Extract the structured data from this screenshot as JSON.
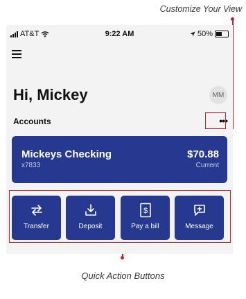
{
  "annotations": {
    "customize": "Customize Your View",
    "quick_actions": "Quick Action Buttons"
  },
  "status_bar": {
    "carrier": "AT&T",
    "time": "9:22 AM",
    "battery": "50%",
    "battery_level": 0.5
  },
  "header": {
    "greeting": "Hi, Mickey",
    "avatar_initials": "MM"
  },
  "accounts": {
    "label": "Accounts",
    "more": "•••",
    "items": [
      {
        "name": "Mickeys Checking",
        "number": "x7833",
        "balance": "$70.88",
        "balance_label": "Current"
      }
    ]
  },
  "quick_actions": [
    {
      "label": "Transfer",
      "icon": "transfer-icon"
    },
    {
      "label": "Deposit",
      "icon": "deposit-icon"
    },
    {
      "label": "Pay a bill",
      "icon": "bill-icon"
    },
    {
      "label": "Message",
      "icon": "message-icon"
    }
  ],
  "colors": {
    "primary": "#26388f",
    "annotation": "#c8202a",
    "background": "#f3f3f3"
  }
}
